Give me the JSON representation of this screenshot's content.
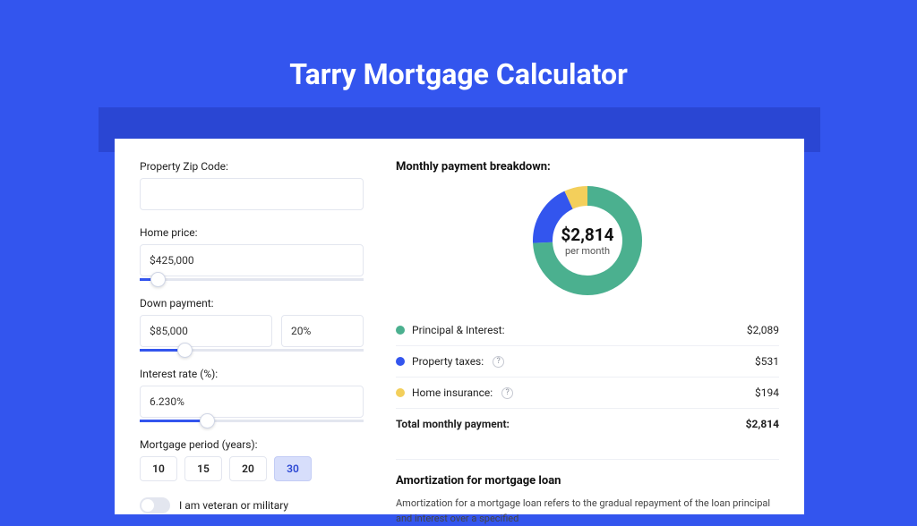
{
  "pageTitle": "Tarry Mortgage Calculator",
  "form": {
    "zip": {
      "label": "Property Zip Code:",
      "value": ""
    },
    "price": {
      "label": "Home price:",
      "value": "$425,000",
      "slider": {
        "pct": 8
      }
    },
    "down": {
      "label": "Down payment:",
      "amount": "$85,000",
      "pct": "20%",
      "slider": {
        "pct": 20
      }
    },
    "rate": {
      "label": "Interest rate (%):",
      "value": "6.230%",
      "slider": {
        "pct": 30
      }
    },
    "period": {
      "label": "Mortgage period (years):",
      "options": [
        "10",
        "15",
        "20",
        "30"
      ],
      "active": "30"
    },
    "veteran": {
      "label": "I am veteran or military",
      "on": false
    }
  },
  "breakdown": {
    "title": "Monthly payment breakdown:",
    "center": {
      "value": "$2,814",
      "sub": "per month"
    },
    "items": [
      {
        "label": "Principal & Interest:",
        "amount": "$2,089",
        "color": "#4bb08f",
        "hasInfo": false
      },
      {
        "label": "Property taxes:",
        "amount": "$531",
        "color": "#3355ee",
        "hasInfo": true
      },
      {
        "label": "Home insurance:",
        "amount": "$194",
        "color": "#f3cf5b",
        "hasInfo": true
      }
    ],
    "total": {
      "label": "Total monthly payment:",
      "amount": "$2,814"
    }
  },
  "amort": {
    "title": "Amortization for mortgage loan",
    "text": "Amortization for a mortgage loan refers to the gradual repayment of the loan principal and interest over a specified"
  },
  "chart_data": {
    "type": "pie",
    "title": "Monthly payment breakdown:",
    "categories": [
      "Principal & Interest",
      "Property taxes",
      "Home insurance"
    ],
    "values": [
      2089,
      531,
      194
    ],
    "colors": [
      "#4bb08f",
      "#3355ee",
      "#f3cf5b"
    ],
    "total": 2814,
    "center_label": "$2,814 per month"
  }
}
